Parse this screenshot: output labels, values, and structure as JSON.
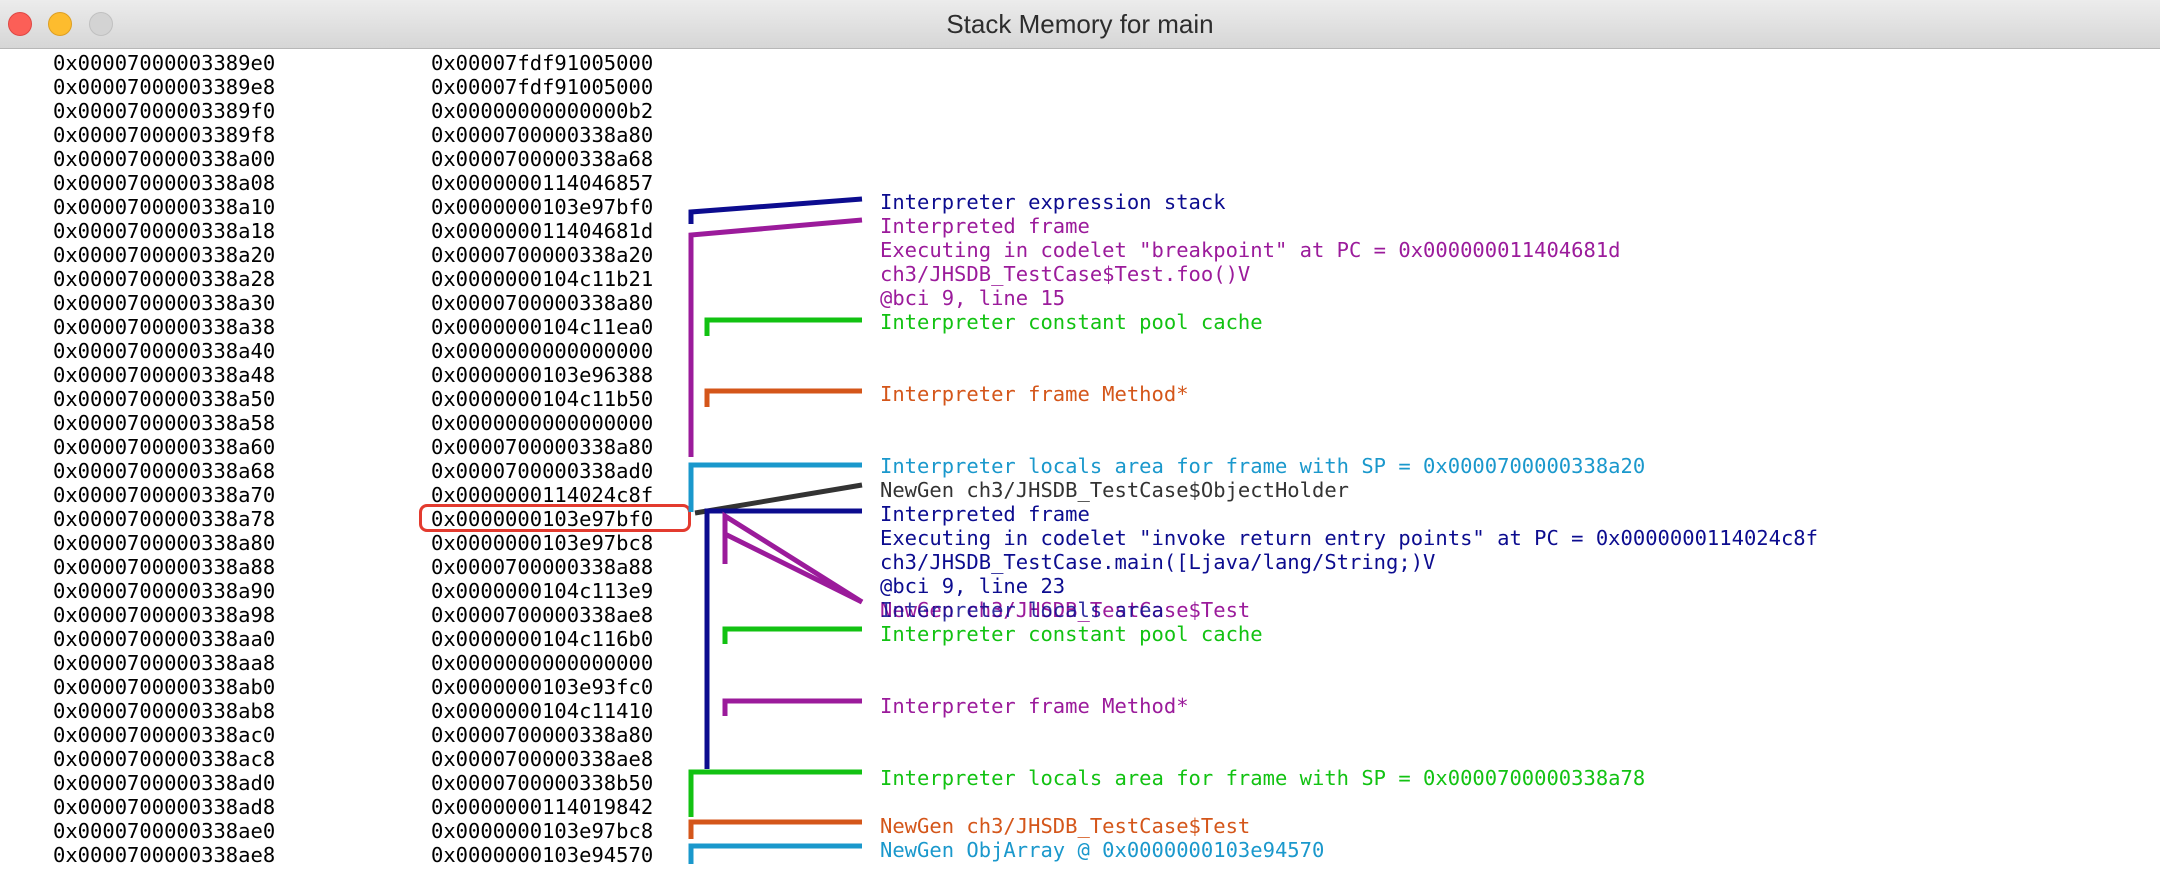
{
  "window": {
    "title": "Stack Memory for main"
  },
  "colors": {
    "navy": "#0c0c8f",
    "purple": "#9b1b9b",
    "green": "#12c212",
    "orange": "#d4561a",
    "cyan": "#1a98cc",
    "gray": "#333333",
    "highlight": "#e33b2f"
  },
  "stack_rows": [
    {
      "addr": "0x00007000003389e0",
      "val": "0x00007fdf91005000"
    },
    {
      "addr": "0x00007000003389e8",
      "val": "0x00007fdf91005000"
    },
    {
      "addr": "0x00007000003389f0",
      "val": "0x00000000000000b2"
    },
    {
      "addr": "0x00007000003389f8",
      "val": "0x0000700000338a80"
    },
    {
      "addr": "0x0000700000338a00",
      "val": "0x0000700000338a68"
    },
    {
      "addr": "0x0000700000338a08",
      "val": "0x0000000114046857"
    },
    {
      "addr": "0x0000700000338a10",
      "val": "0x0000000103e97bf0"
    },
    {
      "addr": "0x0000700000338a18",
      "val": "0x000000011404681d"
    },
    {
      "addr": "0x0000700000338a20",
      "val": "0x0000700000338a20"
    },
    {
      "addr": "0x0000700000338a28",
      "val": "0x0000000104c11b21"
    },
    {
      "addr": "0x0000700000338a30",
      "val": "0x0000700000338a80"
    },
    {
      "addr": "0x0000700000338a38",
      "val": "0x0000000104c11ea0"
    },
    {
      "addr": "0x0000700000338a40",
      "val": "0x0000000000000000"
    },
    {
      "addr": "0x0000700000338a48",
      "val": "0x0000000103e96388"
    },
    {
      "addr": "0x0000700000338a50",
      "val": "0x0000000104c11b50"
    },
    {
      "addr": "0x0000700000338a58",
      "val": "0x0000000000000000"
    },
    {
      "addr": "0x0000700000338a60",
      "val": "0x0000700000338a80"
    },
    {
      "addr": "0x0000700000338a68",
      "val": "0x0000700000338ad0"
    },
    {
      "addr": "0x0000700000338a70",
      "val": "0x0000000114024c8f"
    },
    {
      "addr": "0x0000700000338a78",
      "val": "0x0000000103e97bf0"
    },
    {
      "addr": "0x0000700000338a80",
      "val": "0x0000000103e97bc8"
    },
    {
      "addr": "0x0000700000338a88",
      "val": "0x0000700000338a88"
    },
    {
      "addr": "0x0000700000338a90",
      "val": "0x0000000104c113e9"
    },
    {
      "addr": "0x0000700000338a98",
      "val": "0x0000700000338ae8"
    },
    {
      "addr": "0x0000700000338aa0",
      "val": "0x0000000104c116b0"
    },
    {
      "addr": "0x0000700000338aa8",
      "val": "0x0000000000000000"
    },
    {
      "addr": "0x0000700000338ab0",
      "val": "0x0000000103e93fc0"
    },
    {
      "addr": "0x0000700000338ab8",
      "val": "0x0000000104c11410"
    },
    {
      "addr": "0x0000700000338ac0",
      "val": "0x0000700000338a80"
    },
    {
      "addr": "0x0000700000338ac8",
      "val": "0x0000700000338ae8"
    },
    {
      "addr": "0x0000700000338ad0",
      "val": "0x0000700000338b50"
    },
    {
      "addr": "0x0000700000338ad8",
      "val": "0x0000000114019842"
    },
    {
      "addr": "0x0000700000338ae0",
      "val": "0x0000000103e97bc8"
    },
    {
      "addr": "0x0000700000338ae8",
      "val": "0x0000000103e94570"
    }
  ],
  "annotations": {
    "expr_stack": "Interpreter expression stack",
    "interp_frame_1": "Interpreted frame",
    "codelet_1": "Executing in codelet \"breakpoint\" at PC = 0x000000011404681d",
    "method_1": "ch3/JHSDB_TestCase$Test.foo()V",
    "bci_1": "@bci 9, line 15",
    "cp_cache_1": "Interpreter constant pool cache",
    "frame_method_1": "Interpreter frame Method*",
    "locals_1": "Interpreter locals area for frame with SP = 0x0000700000338a20",
    "objholder": "NewGen ch3/JHSDB_TestCase$ObjectHolder",
    "interp_frame_2": "Interpreted frame",
    "codelet_2": "Executing in codelet \"invoke return entry points\" at PC = 0x0000000114024c8f",
    "method_2": "ch3/JHSDB_TestCase.main([Ljava/lang/String;)V",
    "bci_2": "@bci 9, line 23",
    "overlap_a": "NewGen ch3/JHSDB_TestCase$Test",
    "overlap_b": "Interpreter locals area",
    "cp_cache_2": "Interpreter constant pool cache",
    "frame_method_2": "Interpreter frame Method*",
    "locals_2": "Interpreter locals area for frame with SP = 0x0000700000338a78",
    "newgen_test": "NewGen ch3/JHSDB_TestCase$Test",
    "objarray": "NewGen ObjArray @ 0x0000000103e94570"
  }
}
